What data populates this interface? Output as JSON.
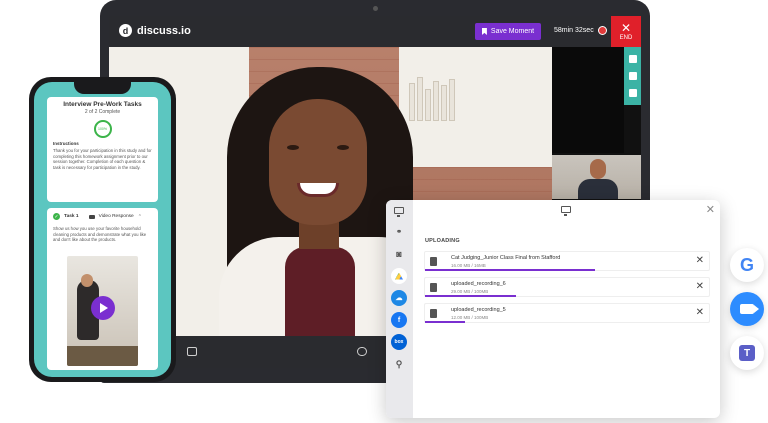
{
  "app": {
    "brand": "discuss.io",
    "save_moment_label": "Save Moment",
    "timer": "58min 32sec",
    "end_label": "END"
  },
  "phone": {
    "card_title": "Interview Pre-Work Tasks",
    "card_subtitle": "2 of 2 Complete",
    "progress_text": "100%",
    "instructions_label": "Instructions",
    "instructions_text": "Thank you for your participation in this study and for completing this homework assignment prior to our session together. Completion of each question & task is necessary for participation in the study.",
    "task_label": "Task 1",
    "task_type": "Video Response",
    "task_text": "Show us how you use your favorite household cleaning products and demonstrate what you like and don't like about the products."
  },
  "upload_panel": {
    "section_title": "UPLOADING",
    "files": [
      {
        "name": "Cat Judging_Junior Class Final from Stafford",
        "size": "16.00 MB / 16MB",
        "progress": 0.6
      },
      {
        "name": "uploaded_recording_6",
        "size": "29.00 MB / 100MB",
        "progress": 0.32
      },
      {
        "name": "uploaded_recording_5",
        "size": "12.00 MB / 100MB",
        "progress": 0.14
      }
    ],
    "rail_icons": [
      "link-icon",
      "camera-icon",
      "google-drive-icon",
      "onedrive-icon",
      "facebook-icon",
      "box-icon",
      "search-icon"
    ],
    "rail_labels": {
      "facebook": "f",
      "box": "box"
    }
  },
  "integrations": [
    "google-icon",
    "zoom-icon",
    "teams-icon"
  ],
  "integration_labels": {
    "google": "G",
    "teams": "T"
  },
  "colors": {
    "accent_purple": "#7a2fd0",
    "end_red": "#e0202a",
    "teal": "#3bb3a5",
    "phone_bg": "#5cc6c0"
  }
}
